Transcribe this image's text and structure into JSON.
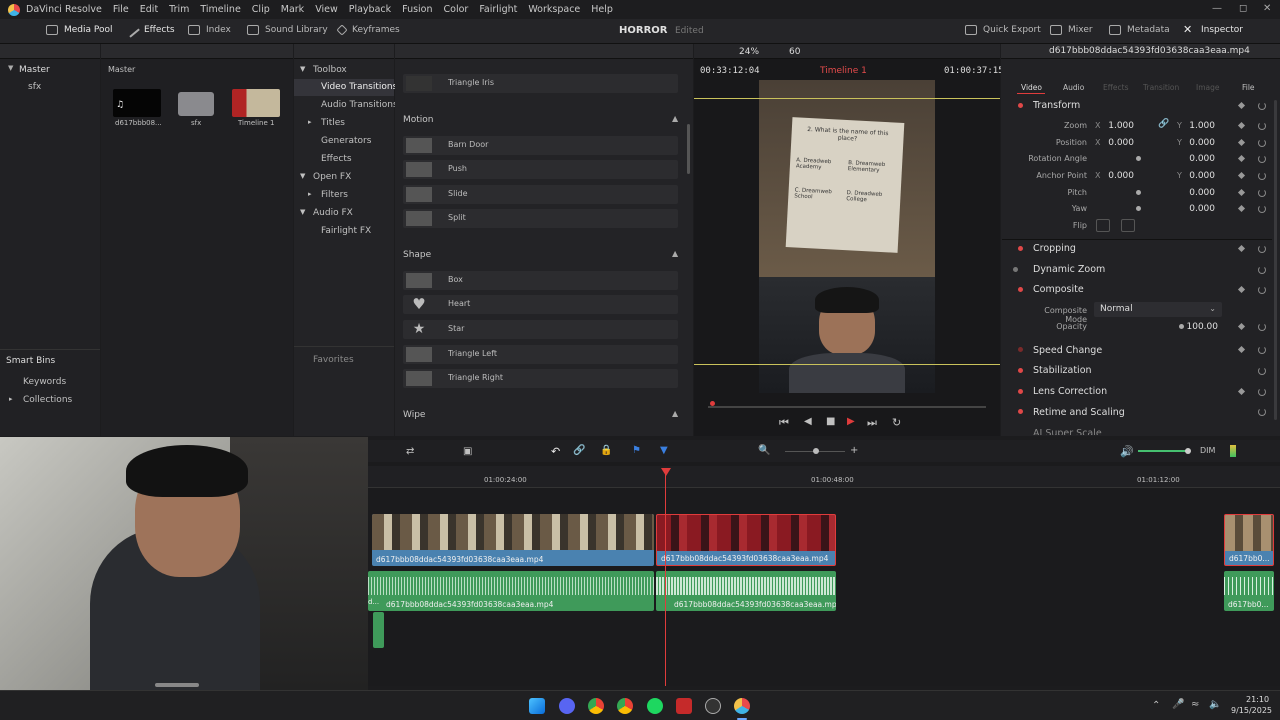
{
  "app": {
    "title": "DaVinci Resolve"
  },
  "menu": [
    "DaVinci Resolve",
    "File",
    "Edit",
    "Trim",
    "Timeline",
    "Clip",
    "Mark",
    "View",
    "Playback",
    "Fusion",
    "Color",
    "Fairlight",
    "Workspace",
    "Help"
  ],
  "toolbar": {
    "media_pool": "Media Pool",
    "effects": "Effects",
    "index": "Index",
    "sound_library": "Sound Library",
    "keyframes": "Keyframes",
    "project_title": "HORROR",
    "project_status": "Edited",
    "quick_export": "Quick Export",
    "mixer": "Mixer",
    "metadata": "Metadata",
    "inspector": "Inspector"
  },
  "media_pool": {
    "root": "Master",
    "bins": [
      "sfx"
    ],
    "header": "Master",
    "clips": [
      {
        "name": "d617bbb08..."
      },
      {
        "name": "sfx"
      },
      {
        "name": "Timeline 1"
      }
    ],
    "smart_bins_label": "Smart Bins",
    "smart_bins": [
      "Keywords",
      "Collections"
    ]
  },
  "effects_tree": {
    "toolbox": "Toolbox",
    "items": [
      "Video Transitions",
      "Audio Transitions",
      "Titles",
      "Generators",
      "Effects",
      "Open FX",
      "Filters",
      "Audio FX",
      "Fairlight FX"
    ],
    "favorites": "Favorites"
  },
  "transitions": {
    "top_item": "Triangle Iris",
    "motion": {
      "title": "Motion",
      "items": [
        "Barn Door",
        "Push",
        "Slide",
        "Split"
      ]
    },
    "shape": {
      "title": "Shape",
      "items": [
        "Box",
        "Heart",
        "Star",
        "Triangle Left",
        "Triangle Right"
      ]
    },
    "wipe": {
      "title": "Wipe"
    }
  },
  "viewer": {
    "zoom": "24%",
    "fps": "60",
    "timecode_left": "00:33:12:04",
    "timeline_name": "Timeline 1",
    "timecode_right": "01:00:37:15",
    "card_title": "2. What is the name of this place?",
    "card_options": [
      "A. Dreadweb Academy",
      "B. Dreamweb Elementary",
      "C. Dreamweb School",
      "D. Dreadweb College"
    ]
  },
  "inspector": {
    "clip_name": "d617bbb08ddac54393fd03638caa3eaa.mp4",
    "tabs": [
      "Video",
      "Audio",
      "Effects",
      "Transition",
      "Image",
      "File"
    ],
    "transform": {
      "title": "Transform",
      "zoom_label": "Zoom",
      "zoom_x": "1.000",
      "zoom_y": "1.000",
      "position_label": "Position",
      "position_x": "0.000",
      "position_y": "0.000",
      "rotation_label": "Rotation Angle",
      "rotation": "0.000",
      "anchor_label": "Anchor Point",
      "anchor_x": "0.000",
      "anchor_y": "0.000",
      "pitch_label": "Pitch",
      "pitch": "0.000",
      "yaw_label": "Yaw",
      "yaw": "0.000",
      "flip_label": "Flip",
      "x_axis": "X",
      "y_axis": "Y"
    },
    "cropping": "Cropping",
    "dynamic_zoom": "Dynamic Zoom",
    "composite": {
      "title": "Composite",
      "mode_label": "Composite Mode",
      "mode": "Normal",
      "opacity_label": "Opacity",
      "opacity": "100.00"
    },
    "sections": [
      "Speed Change",
      "Stabilization",
      "Lens Correction",
      "Retime and Scaling",
      "AI Super Scale"
    ]
  },
  "timeline": {
    "ruler": [
      "01:00:24:00",
      "01:00:48:00",
      "01:01:12:00"
    ],
    "clip_name": "d617bbb08ddac54393fd03638caa3eaa.mp4",
    "clip_short": "d617bb0...",
    "audio_stub": "d...",
    "dim": "DIM"
  },
  "clock": {
    "time": "21:10",
    "date": "9/15/2025"
  },
  "colors": {
    "accent_red": "#e03c3c",
    "video_clip": "#4a82b0",
    "audio_clip": "#3f9a5a",
    "playhead": "#e03c3c"
  }
}
